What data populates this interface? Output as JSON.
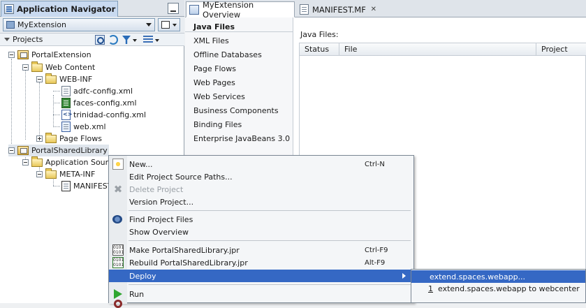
{
  "navigator": {
    "title": "Application Navigator",
    "application": "MyExtension",
    "projects_label": "Projects",
    "tree": [
      {
        "label": "PortalExtension"
      },
      {
        "label": "Web Content"
      },
      {
        "label": "WEB-INF"
      },
      {
        "label": "adfc-config.xml"
      },
      {
        "label": "faces-config.xml"
      },
      {
        "label": "trinidad-config.xml"
      },
      {
        "label": "web.xml"
      },
      {
        "label": "Page Flows"
      },
      {
        "label": "PortalSharedLibrary"
      },
      {
        "label": "Application Sour"
      },
      {
        "label": "META-INF"
      },
      {
        "label": "MANIFEST"
      }
    ]
  },
  "editor": {
    "tabs": [
      {
        "label": "MyExtension Overview"
      },
      {
        "label": "MANIFEST.MF"
      }
    ],
    "categories": [
      {
        "label": "Java Files"
      },
      {
        "label": "XML Files"
      },
      {
        "label": "Offline Databases"
      },
      {
        "label": "Page Flows"
      },
      {
        "label": "Web Pages"
      },
      {
        "label": "Web Services"
      },
      {
        "label": "Business Components"
      },
      {
        "label": "Binding Files"
      },
      {
        "label": "Enterprise JavaBeans 3.0"
      }
    ],
    "files_label": "Java Files:",
    "columns": [
      "Status",
      "File",
      "Project"
    ]
  },
  "context_menu": {
    "items": [
      {
        "label": "New...",
        "shortcut": "Ctrl-N"
      },
      {
        "label": "Edit Project Source Paths..."
      },
      {
        "label": "Delete Project"
      },
      {
        "label": "Version Project..."
      },
      {
        "label": "Find Project Files"
      },
      {
        "label": "Show Overview"
      },
      {
        "label": "Make PortalSharedLibrary.jpr",
        "shortcut": "Ctrl-F9"
      },
      {
        "label": "Rebuild PortalSharedLibrary.jpr",
        "shortcut": "Alt-F9"
      },
      {
        "label": "Deploy"
      },
      {
        "label": "Run"
      }
    ]
  },
  "deploy_submenu": {
    "items": [
      {
        "label": "extend.spaces.webapp..."
      },
      {
        "number": "1",
        "label": "extend.spaces.webapp to webcenter"
      }
    ]
  },
  "colors": {
    "selection": "#3568c4",
    "tab_active": "#c9daf0"
  }
}
